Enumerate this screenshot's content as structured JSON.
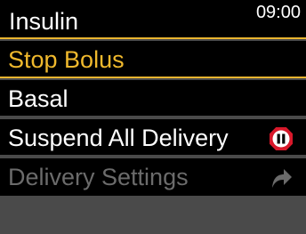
{
  "header": {
    "title": "Insulin",
    "time": "09:00"
  },
  "menu": {
    "items": [
      {
        "label": "Stop Bolus",
        "state": "selected"
      },
      {
        "label": "Basal",
        "state": "enabled"
      },
      {
        "label": "Suspend All Delivery",
        "state": "enabled",
        "icon": "pause-stop-icon"
      },
      {
        "label": "Delivery Settings",
        "state": "disabled",
        "icon": "forward-arrow-icon"
      }
    ]
  },
  "colors": {
    "accent": "#f0b92d",
    "background": "#000000",
    "disabled_text": "#6b6b6b",
    "stop_icon": "#d8182a"
  }
}
